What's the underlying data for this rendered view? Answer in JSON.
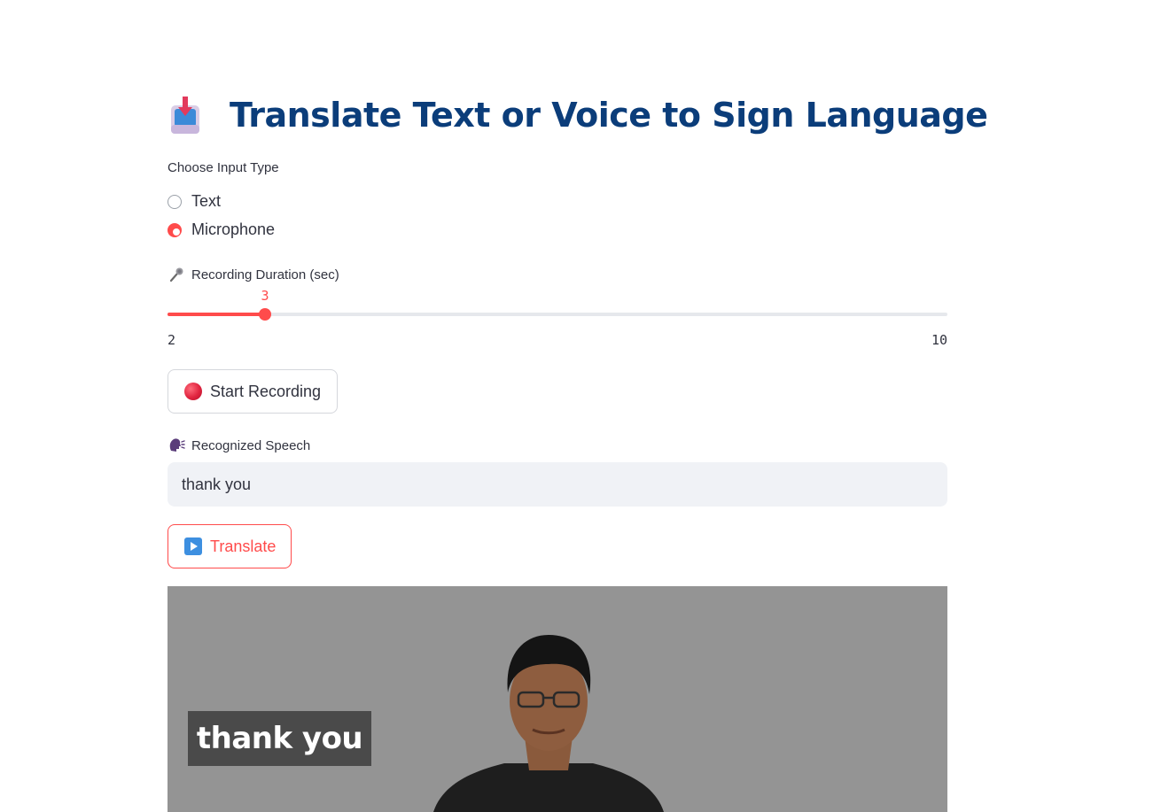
{
  "header": {
    "title": "Translate Text or Voice to Sign Language",
    "icon": "inbox-tray-icon"
  },
  "input_type": {
    "label": "Choose Input Type",
    "options": [
      "Text",
      "Microphone"
    ],
    "selected": "Microphone"
  },
  "duration": {
    "label": "Recording Duration (sec)",
    "icon": "microphone-icon",
    "min": 2,
    "max": 10,
    "value": 3,
    "min_label": "2",
    "max_label": "10",
    "value_label": "3"
  },
  "record_button": {
    "label": "Start Recording",
    "icon": "red-circle-icon"
  },
  "speech": {
    "label": "Recognized Speech",
    "icon": "speaking-head-icon",
    "value": "thank you"
  },
  "translate_button": {
    "label": "Translate",
    "icon": "play-button-icon"
  },
  "video": {
    "caption": "thank you"
  },
  "colors": {
    "accent": "#ff4b4b",
    "title": "#0b3d7a",
    "video_bg": "#949494"
  }
}
